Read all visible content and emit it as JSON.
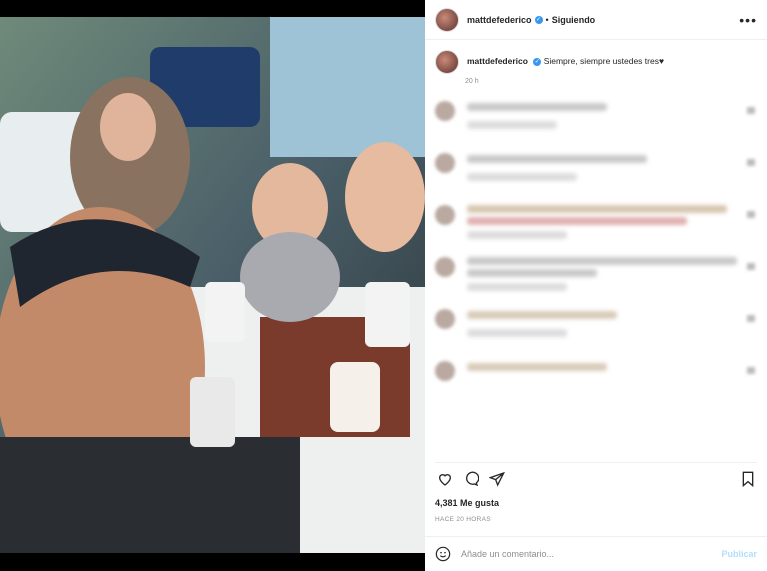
{
  "header": {
    "username": "mattdefederico",
    "separator": "•",
    "follow_label": "Siguiendo",
    "more_label": "•••"
  },
  "caption": {
    "username": "mattdefederico",
    "text": "Siempre, siempre ustedes tres♥",
    "time": "20 h"
  },
  "comments": [
    {
      "text": "[blurred]"
    },
    {
      "text": "[blurred]"
    },
    {
      "text": "[blurred]"
    },
    {
      "text": "[blurred]"
    },
    {
      "text": "[blurred]"
    },
    {
      "text": "[blurred]"
    }
  ],
  "post": {
    "likes": "4,381 Me gusta",
    "posted_ago": "HACE 20 HORAS"
  },
  "composer": {
    "placeholder": "Añade un comentario...",
    "publish_label": "Publicar"
  },
  "colors": {
    "verified": "#3897f0",
    "publish": "#b2dffc"
  }
}
